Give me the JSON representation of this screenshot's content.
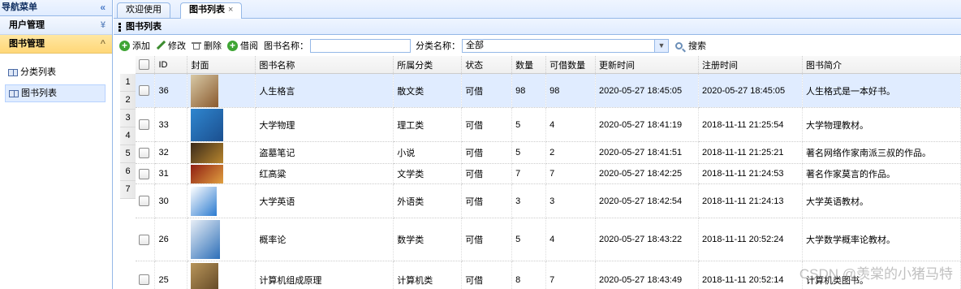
{
  "sidebar": {
    "title": "导航菜单",
    "collapse_glyph": "«",
    "groups": [
      {
        "label": "用户管理",
        "arrow": "¥"
      },
      {
        "label": "图书管理",
        "arrow": "^"
      }
    ],
    "items": [
      {
        "label": "分类列表"
      },
      {
        "label": "图书列表"
      }
    ]
  },
  "tabs": [
    {
      "label": "欢迎使用"
    },
    {
      "label": "图书列表",
      "close": "×"
    }
  ],
  "panel": {
    "title": "图书列表"
  },
  "toolbar": {
    "add": "添加",
    "edit": "修改",
    "delete": "删除",
    "borrow": "借阅",
    "name_label": "图书名称：",
    "name_value": "",
    "category_label": "分类名称：",
    "category_value": "全部",
    "search": "搜索"
  },
  "grid": {
    "columns": [
      "ID",
      "封面",
      "图书名称",
      "所属分类",
      "状态",
      "数量",
      "可借数量",
      "更新时间",
      "注册时间",
      "图书简介"
    ],
    "row_numbers": [
      "1",
      "2",
      "3",
      "4",
      "5",
      "6",
      "7"
    ],
    "rows": [
      {
        "id": "36",
        "name": "人生格言",
        "category": "散文类",
        "status": "可借",
        "quantity": "98",
        "available": "98",
        "updated": "2020-05-27 18:45:05",
        "registered": "2020-05-27 18:45:05",
        "intro": "人生格式是一本好书。",
        "cover_colors": [
          "#d8c9a6",
          "#8a5a2e"
        ]
      },
      {
        "id": "33",
        "name": "大学物理",
        "category": "理工类",
        "status": "可借",
        "quantity": "5",
        "available": "4",
        "updated": "2020-05-27 18:41:19",
        "registered": "2018-11-11 21:25:54",
        "intro": "大学物理教材。",
        "cover_colors": [
          "#2f86cf",
          "#1b4f8f"
        ]
      },
      {
        "id": "32",
        "name": "盗墓笔记",
        "category": "小说",
        "status": "可借",
        "quantity": "5",
        "available": "2",
        "updated": "2020-05-27 18:41:51",
        "registered": "2018-11-11 21:25:21",
        "intro": "著名网络作家南派三叔的作品。",
        "cover_colors": [
          "#3a2a1a",
          "#b8862e"
        ]
      },
      {
        "id": "31",
        "name": "红高粱",
        "category": "文学类",
        "status": "可借",
        "quantity": "7",
        "available": "7",
        "updated": "2020-05-27 18:42:25",
        "registered": "2018-11-11 21:24:53",
        "intro": "著名作家莫言的作品。",
        "cover_colors": [
          "#8f1d12",
          "#e0a040"
        ]
      },
      {
        "id": "30",
        "name": "大学英语",
        "category": "外语类",
        "status": "可借",
        "quantity": "3",
        "available": "3",
        "updated": "2020-05-27 18:42:54",
        "registered": "2018-11-11 21:24:13",
        "intro": "大学英语教材。",
        "cover_colors": [
          "#ffffff",
          "#2b7bd0"
        ]
      },
      {
        "id": "26",
        "name": "概率论",
        "category": "数学类",
        "status": "可借",
        "quantity": "5",
        "available": "4",
        "updated": "2020-05-27 18:43:22",
        "registered": "2018-11-11 20:52:24",
        "intro": "大学数学概率论教材。",
        "cover_colors": [
          "#e8eef6",
          "#2d6fb8"
        ]
      },
      {
        "id": "25",
        "name": "计算机组成原理",
        "category": "计算机类",
        "status": "可借",
        "quantity": "8",
        "available": "7",
        "updated": "2020-05-27 18:43:49",
        "registered": "2018-11-11 20:52:14",
        "intro": "计算机类图书。",
        "cover_colors": [
          "#b8955a",
          "#5a4020"
        ]
      }
    ]
  },
  "watermark": "CSDN @羡棠的小猪马特"
}
